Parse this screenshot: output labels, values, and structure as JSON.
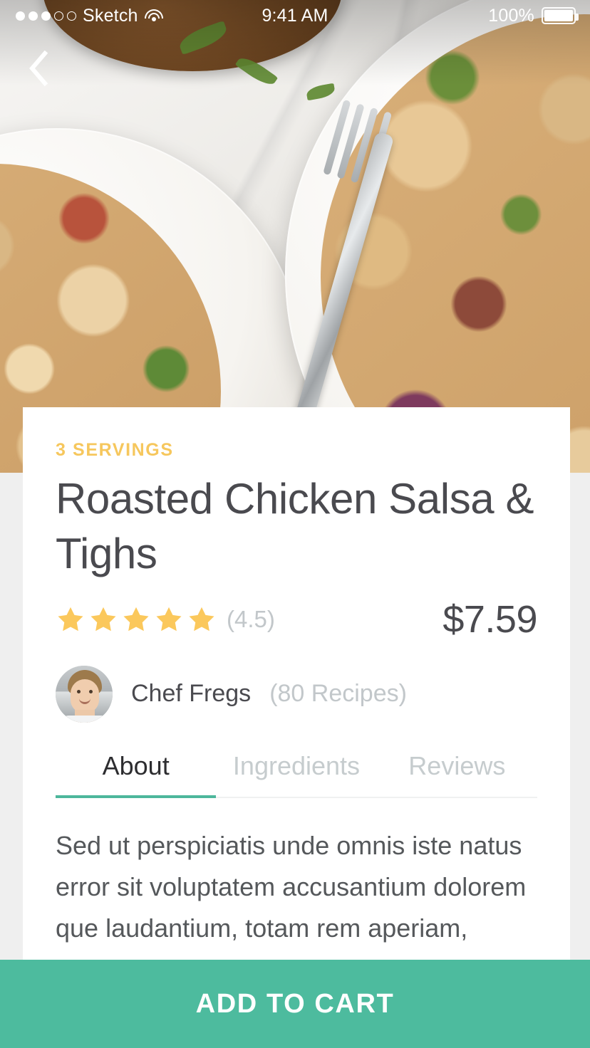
{
  "status_bar": {
    "carrier": "Sketch",
    "time": "9:41 AM",
    "battery_percent": "100%",
    "signal_dots_filled": 3,
    "signal_dots_total": 5,
    "wifi_icon": "wifi-icon",
    "battery_icon": "battery-full-icon"
  },
  "nav": {
    "back_icon": "chevron-left-icon"
  },
  "hero": {
    "image_alt": "Two white bowls of rigatoni pasta with red onion, tomato and basil on marble with a fork"
  },
  "recipe": {
    "servings": "3 SERVINGS",
    "title": "Roasted Chicken Salsa & Tighs",
    "rating_value": "(4.5)",
    "rating_stars": 5,
    "price": "$7.59",
    "star_icon": "star-filled-icon"
  },
  "chef": {
    "avatar_icon": "avatar-photo",
    "name": "Chef Fregs",
    "recipes_count": "(80 Recipes)"
  },
  "tabs": [
    {
      "label": "About",
      "active": true
    },
    {
      "label": "Ingredients",
      "active": false
    },
    {
      "label": "Reviews",
      "active": false
    }
  ],
  "about": {
    "body": "Sed ut perspiciatis unde omnis iste natus error sit voluptatem accusantium dolorem que laudantium, totam rem aperiam, eaque ipsa quae ab illo invent ore veritatis"
  },
  "cta": {
    "label": "ADD TO CART"
  },
  "colors": {
    "accent_green": "#4DBB9E",
    "tab_underline": "#4DB79B",
    "servings_gold": "#F6C75D",
    "star_gold": "#FBC85C",
    "text_dark": "#4A4A4F",
    "text_muted": "#C2C7CA",
    "card_bg": "#FFFFFF"
  }
}
